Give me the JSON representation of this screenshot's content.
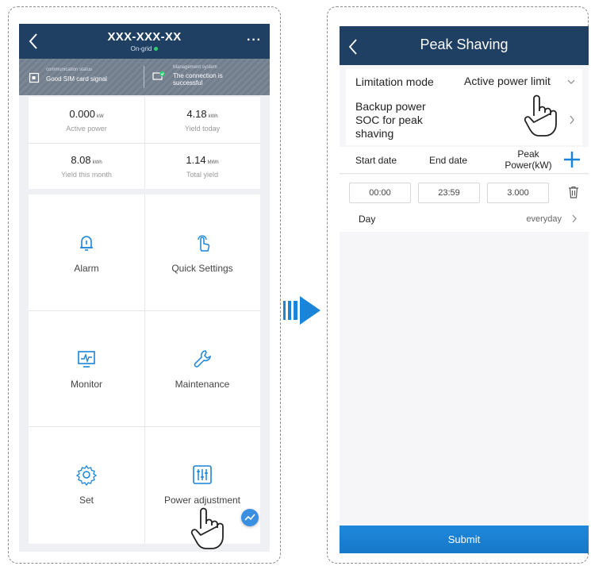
{
  "left_screen": {
    "header": {
      "title": "XXX-XXX-XX",
      "status": "On-grid"
    },
    "status_bar": {
      "communication": {
        "label": "communication status",
        "value": "Good SIM card signal"
      },
      "management": {
        "label": "Management system",
        "value_line1": "The connection is",
        "value_line2": "successful"
      }
    },
    "stats": [
      {
        "value": "0.000",
        "unit": "kW",
        "label": "Active power"
      },
      {
        "value": "4.18",
        "unit": "kWh",
        "label": "Yield today"
      },
      {
        "value": "8.08",
        "unit": "kWh",
        "label": "Yield this month"
      },
      {
        "value": "1.14",
        "unit": "MWh",
        "label": "Total yield"
      }
    ],
    "menu": [
      {
        "label": "Alarm",
        "icon": "bell-icon"
      },
      {
        "label": "Quick Settings",
        "icon": "tap-icon"
      },
      {
        "label": "Monitor",
        "icon": "monitor-icon"
      },
      {
        "label": "Maintenance",
        "icon": "wrench-icon"
      },
      {
        "label": "Set",
        "icon": "gear-icon"
      },
      {
        "label": "Power adjustment",
        "icon": "sliders-icon"
      }
    ]
  },
  "right_screen": {
    "header": {
      "title": "Peak Shaving"
    },
    "limitation_mode": {
      "label": "Limitation mode",
      "value": "Active power limit"
    },
    "backup": {
      "line1": "Backup power",
      "line2": "SOC for peak",
      "line3": "shaving"
    },
    "schedule_header": {
      "start": "Start date",
      "end": "End date",
      "peak_line1": "Peak",
      "peak_line2": "Power(kW)"
    },
    "schedule_row": {
      "start": "00:00",
      "end": "23:59",
      "power": "3.000",
      "day_label": "Day",
      "day_value": "everyday"
    },
    "submit_label": "Submit"
  },
  "colors": {
    "header": "#1f3f63",
    "accent": "#1a84d8",
    "online": "#2ed16f"
  }
}
